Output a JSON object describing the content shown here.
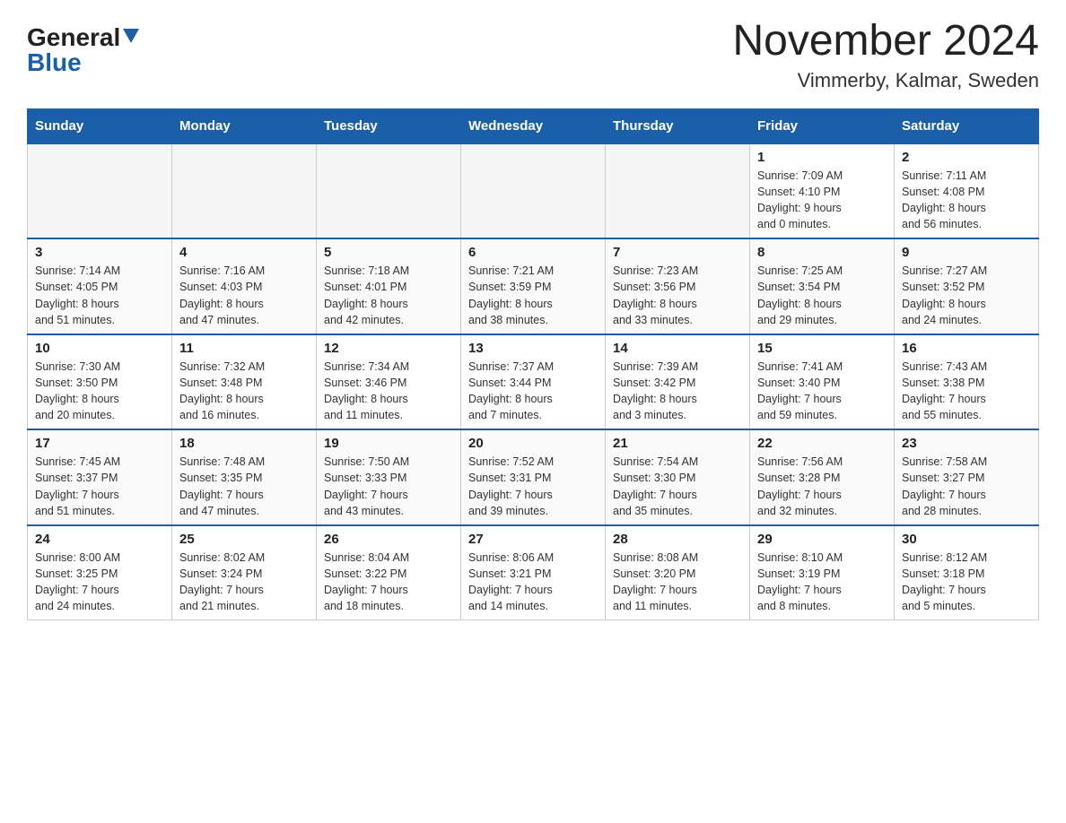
{
  "header": {
    "logo_general": "General",
    "logo_blue": "Blue",
    "month_title": "November 2024",
    "location": "Vimmerby, Kalmar, Sweden"
  },
  "weekdays": [
    "Sunday",
    "Monday",
    "Tuesday",
    "Wednesday",
    "Thursday",
    "Friday",
    "Saturday"
  ],
  "weeks": [
    [
      {
        "day": "",
        "info": ""
      },
      {
        "day": "",
        "info": ""
      },
      {
        "day": "",
        "info": ""
      },
      {
        "day": "",
        "info": ""
      },
      {
        "day": "",
        "info": ""
      },
      {
        "day": "1",
        "info": "Sunrise: 7:09 AM\nSunset: 4:10 PM\nDaylight: 9 hours\nand 0 minutes."
      },
      {
        "day": "2",
        "info": "Sunrise: 7:11 AM\nSunset: 4:08 PM\nDaylight: 8 hours\nand 56 minutes."
      }
    ],
    [
      {
        "day": "3",
        "info": "Sunrise: 7:14 AM\nSunset: 4:05 PM\nDaylight: 8 hours\nand 51 minutes."
      },
      {
        "day": "4",
        "info": "Sunrise: 7:16 AM\nSunset: 4:03 PM\nDaylight: 8 hours\nand 47 minutes."
      },
      {
        "day": "5",
        "info": "Sunrise: 7:18 AM\nSunset: 4:01 PM\nDaylight: 8 hours\nand 42 minutes."
      },
      {
        "day": "6",
        "info": "Sunrise: 7:21 AM\nSunset: 3:59 PM\nDaylight: 8 hours\nand 38 minutes."
      },
      {
        "day": "7",
        "info": "Sunrise: 7:23 AM\nSunset: 3:56 PM\nDaylight: 8 hours\nand 33 minutes."
      },
      {
        "day": "8",
        "info": "Sunrise: 7:25 AM\nSunset: 3:54 PM\nDaylight: 8 hours\nand 29 minutes."
      },
      {
        "day": "9",
        "info": "Sunrise: 7:27 AM\nSunset: 3:52 PM\nDaylight: 8 hours\nand 24 minutes."
      }
    ],
    [
      {
        "day": "10",
        "info": "Sunrise: 7:30 AM\nSunset: 3:50 PM\nDaylight: 8 hours\nand 20 minutes."
      },
      {
        "day": "11",
        "info": "Sunrise: 7:32 AM\nSunset: 3:48 PM\nDaylight: 8 hours\nand 16 minutes."
      },
      {
        "day": "12",
        "info": "Sunrise: 7:34 AM\nSunset: 3:46 PM\nDaylight: 8 hours\nand 11 minutes."
      },
      {
        "day": "13",
        "info": "Sunrise: 7:37 AM\nSunset: 3:44 PM\nDaylight: 8 hours\nand 7 minutes."
      },
      {
        "day": "14",
        "info": "Sunrise: 7:39 AM\nSunset: 3:42 PM\nDaylight: 8 hours\nand 3 minutes."
      },
      {
        "day": "15",
        "info": "Sunrise: 7:41 AM\nSunset: 3:40 PM\nDaylight: 7 hours\nand 59 minutes."
      },
      {
        "day": "16",
        "info": "Sunrise: 7:43 AM\nSunset: 3:38 PM\nDaylight: 7 hours\nand 55 minutes."
      }
    ],
    [
      {
        "day": "17",
        "info": "Sunrise: 7:45 AM\nSunset: 3:37 PM\nDaylight: 7 hours\nand 51 minutes."
      },
      {
        "day": "18",
        "info": "Sunrise: 7:48 AM\nSunset: 3:35 PM\nDaylight: 7 hours\nand 47 minutes."
      },
      {
        "day": "19",
        "info": "Sunrise: 7:50 AM\nSunset: 3:33 PM\nDaylight: 7 hours\nand 43 minutes."
      },
      {
        "day": "20",
        "info": "Sunrise: 7:52 AM\nSunset: 3:31 PM\nDaylight: 7 hours\nand 39 minutes."
      },
      {
        "day": "21",
        "info": "Sunrise: 7:54 AM\nSunset: 3:30 PM\nDaylight: 7 hours\nand 35 minutes."
      },
      {
        "day": "22",
        "info": "Sunrise: 7:56 AM\nSunset: 3:28 PM\nDaylight: 7 hours\nand 32 minutes."
      },
      {
        "day": "23",
        "info": "Sunrise: 7:58 AM\nSunset: 3:27 PM\nDaylight: 7 hours\nand 28 minutes."
      }
    ],
    [
      {
        "day": "24",
        "info": "Sunrise: 8:00 AM\nSunset: 3:25 PM\nDaylight: 7 hours\nand 24 minutes."
      },
      {
        "day": "25",
        "info": "Sunrise: 8:02 AM\nSunset: 3:24 PM\nDaylight: 7 hours\nand 21 minutes."
      },
      {
        "day": "26",
        "info": "Sunrise: 8:04 AM\nSunset: 3:22 PM\nDaylight: 7 hours\nand 18 minutes."
      },
      {
        "day": "27",
        "info": "Sunrise: 8:06 AM\nSunset: 3:21 PM\nDaylight: 7 hours\nand 14 minutes."
      },
      {
        "day": "28",
        "info": "Sunrise: 8:08 AM\nSunset: 3:20 PM\nDaylight: 7 hours\nand 11 minutes."
      },
      {
        "day": "29",
        "info": "Sunrise: 8:10 AM\nSunset: 3:19 PM\nDaylight: 7 hours\nand 8 minutes."
      },
      {
        "day": "30",
        "info": "Sunrise: 8:12 AM\nSunset: 3:18 PM\nDaylight: 7 hours\nand 5 minutes."
      }
    ]
  ]
}
